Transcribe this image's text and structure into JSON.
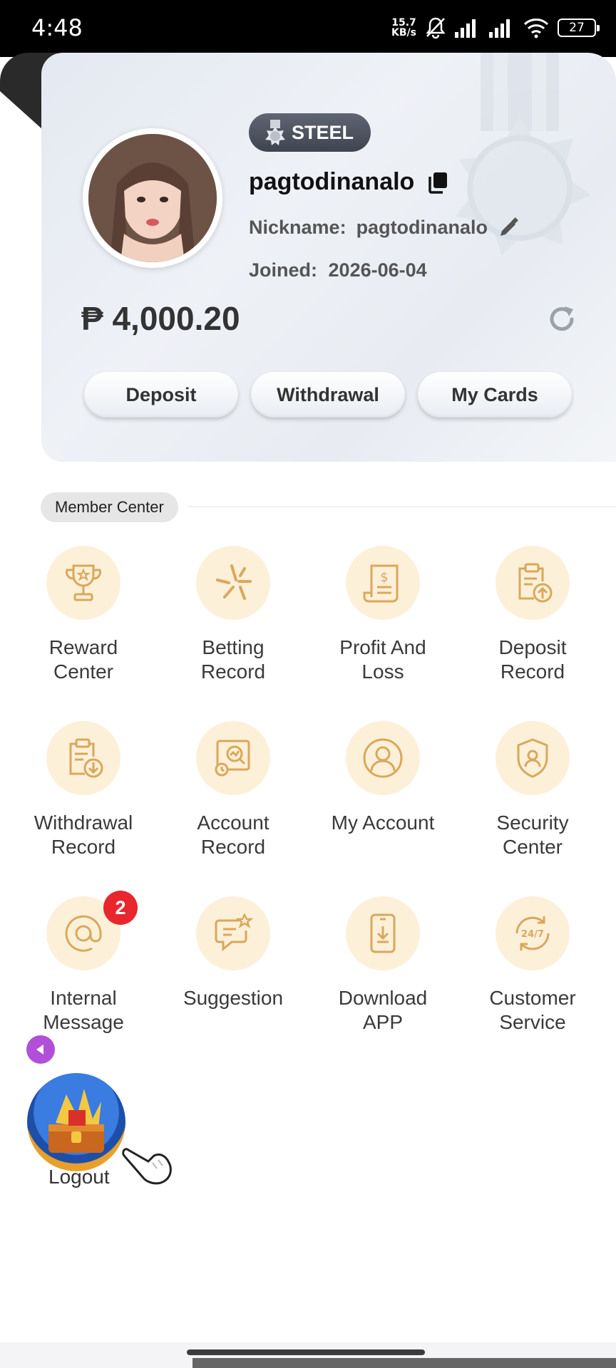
{
  "status_bar": {
    "time": "4:48",
    "net_speed_value": "15.7",
    "net_speed_unit": "KB/s",
    "battery": "27"
  },
  "profile": {
    "level_badge": "STEEL",
    "username": "pagtodinanalo",
    "nickname_label": "Nickname:",
    "nickname": "pagtodinanalo",
    "joined_label": "Joined:",
    "joined_date": "2026-06-04",
    "balance": "₱ 4,000.20"
  },
  "actions": {
    "deposit": "Deposit",
    "withdrawal": "Withdrawal",
    "my_cards": "My Cards"
  },
  "member_center": {
    "title": "Member Center",
    "items": [
      {
        "line1": "Reward",
        "line2": "Center",
        "icon": "trophy-icon"
      },
      {
        "line1": "Betting",
        "line2": "Record",
        "icon": "betting-icon"
      },
      {
        "line1": "Profit And",
        "line2": "Loss",
        "icon": "receipt-dollar-icon"
      },
      {
        "line1": "Deposit",
        "line2": "Record",
        "icon": "clipboard-upload-icon"
      },
      {
        "line1": "Withdrawal",
        "line2": "Record",
        "icon": "clipboard-download-icon"
      },
      {
        "line1": "Account",
        "line2": "Record",
        "icon": "chart-record-icon"
      },
      {
        "line1": "My Account",
        "line2": "",
        "icon": "user-circle-icon"
      },
      {
        "line1": "Security",
        "line2": "Center",
        "icon": "shield-user-icon"
      },
      {
        "line1": "Internal",
        "line2": "Message",
        "icon": "at-icon"
      },
      {
        "line1": "Suggestion",
        "line2": "",
        "icon": "chat-star-icon"
      },
      {
        "line1": "Download",
        "line2": "APP",
        "icon": "phone-download-icon"
      },
      {
        "line1": "Customer",
        "line2": "Service",
        "icon": "support-247-icon"
      }
    ],
    "message_badge": "2"
  },
  "logout": "Logout",
  "colors": {
    "icon_bg": "#fdf0d9",
    "icon_stroke": "#d9a85a",
    "badge_red": "#e8262d"
  }
}
